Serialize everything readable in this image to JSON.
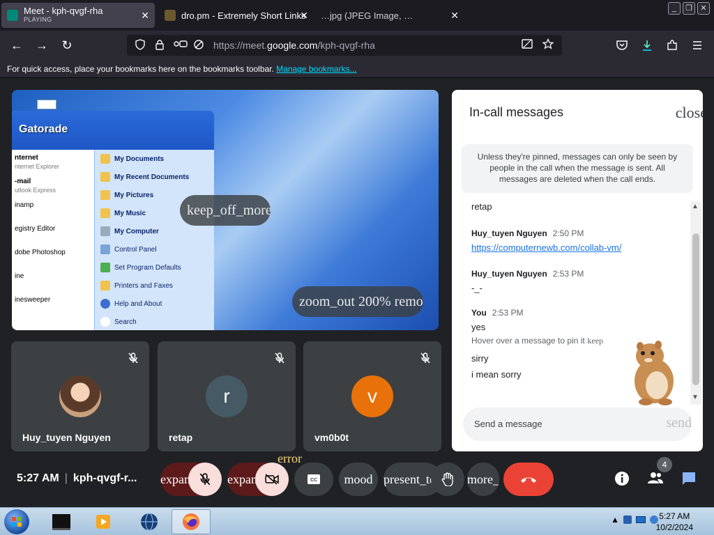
{
  "tabs": [
    {
      "title": "Meet - kph-qvgf-rha",
      "subtitle": "PLAYING",
      "close": "✕"
    },
    {
      "title": "dro.pm - Extremely Short Links",
      "close": "✕"
    },
    {
      "title": "…jpg (JPEG Image, …",
      "close": "✕"
    }
  ],
  "window_controls": {
    "minimize": "_",
    "restore": "❐",
    "close": "✕"
  },
  "nav": {
    "back": "←",
    "forward": "→",
    "reload": "↻"
  },
  "urlbar": {
    "url_prefix": "https://meet.",
    "url_host": "google.com",
    "url_suffix": "/kph-qvgf-rha"
  },
  "bookmarks_bar": {
    "text": "For quick access, place your bookmarks here on the bookmarks toolbar.",
    "link": "Manage bookmarks..."
  },
  "presentation": {
    "start_menu_user": "Gatorade",
    "left_items": [
      {
        "main": "nternet",
        "sub": "nternet Explorer"
      },
      {
        "main": "-mail",
        "sub": "utlook Express"
      },
      {
        "main": "inamp",
        "sub": ""
      },
      {
        "main": "egistry Editor",
        "sub": ""
      },
      {
        "main": "dobe Photoshop",
        "sub": ""
      },
      {
        "main": "ine",
        "sub": ""
      },
      {
        "main": "inesweeper",
        "sub": ""
      }
    ],
    "right_items": [
      "My Documents",
      "My Recent Documents",
      "My Pictures",
      "My Music",
      "My Computer",
      "Control Panel",
      "Set Program Defaults",
      "Printers and Faxes",
      "Help and About",
      "Search"
    ],
    "overlay_top": "keep_off_more_vert",
    "overlay_bottom": "zoom_out 200% remove"
  },
  "participants": [
    {
      "name": "Huy_tuyen Nguyen",
      "initial": "",
      "avatar_color": "#d8b48f"
    },
    {
      "name": "retap",
      "initial": "r",
      "avatar_color": "#455a64"
    },
    {
      "name": "vm0b0t",
      "initial": "v",
      "avatar_color": "#e8710a"
    }
  ],
  "mute_icon": "🎙",
  "panel": {
    "title": "In-call messages",
    "close": "close",
    "notice": "Unless they're pinned, messages can only be seen by people in the call when the message is sent. All messages are deleted when the call ends.",
    "messages": [
      {
        "sender": "",
        "time": "",
        "lines": [
          "retap"
        ]
      },
      {
        "sender": "Huy_tuyen Nguyen",
        "time": "2:50 PM",
        "link": "https://computernewb.com/collab-vm/"
      },
      {
        "sender": "Huy_tuyen Nguyen",
        "time": "2:53 PM",
        "lines": [
          "-_-"
        ]
      },
      {
        "sender": "You",
        "time": "2:53 PM",
        "lines": [
          "yes"
        ],
        "hint": "Hover over a message to pin it",
        "hint_icon": "keep"
      },
      {
        "sender": "",
        "time": "",
        "lines": [
          "sirry",
          "i mean sorry"
        ]
      }
    ],
    "composer_placeholder": "Send a message",
    "send": "send"
  },
  "controls": {
    "time": "5:27 AM",
    "meeting_code": "kph-qvgf-r...",
    "buttons": [
      "expand_less",
      "mic_off",
      "expand_less",
      "videocam_off",
      "closed_caption",
      "mood",
      "present_to_all",
      "back_hand",
      "more_vert",
      "call_end"
    ],
    "error": "error",
    "people_count": "4"
  },
  "taskbar": {
    "clock_time": "5:27 AM",
    "clock_date": "10/2/2024"
  }
}
